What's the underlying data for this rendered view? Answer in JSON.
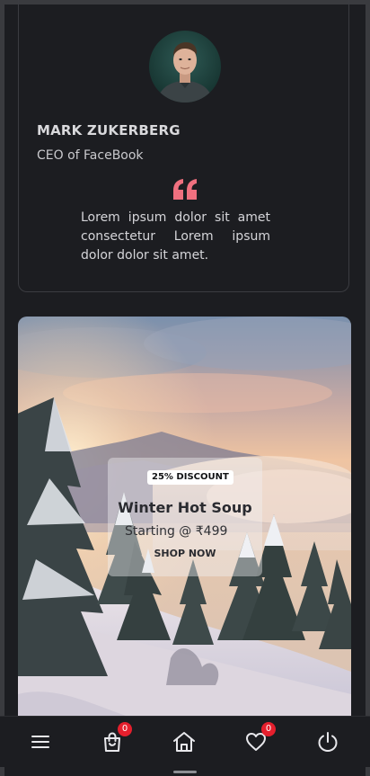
{
  "testimonial": {
    "name": "MARK ZUKERBERG",
    "title": "CEO of FaceBook",
    "quote": "Lorem ipsum dolor sit amet consectetur Lorem ipsum dolor dolor sit amet.",
    "quote_icon": "quote-icon",
    "accent_color": "#f0707f"
  },
  "banner": {
    "discount": "25% DISCOUNT",
    "title": "Winter Hot Soup",
    "price": "Starting @ ₹499",
    "cta": "SHOP NOW"
  },
  "bottom_nav": {
    "items": [
      {
        "icon": "menu-icon"
      },
      {
        "icon": "shopping-bag-icon",
        "badge": "0"
      },
      {
        "icon": "home-icon"
      },
      {
        "icon": "heart-icon",
        "badge": "0"
      },
      {
        "icon": "power-icon"
      }
    ]
  },
  "colors": {
    "background": "#1c1d21",
    "badge": "#e51f2d",
    "text": "#d9d9dc"
  }
}
